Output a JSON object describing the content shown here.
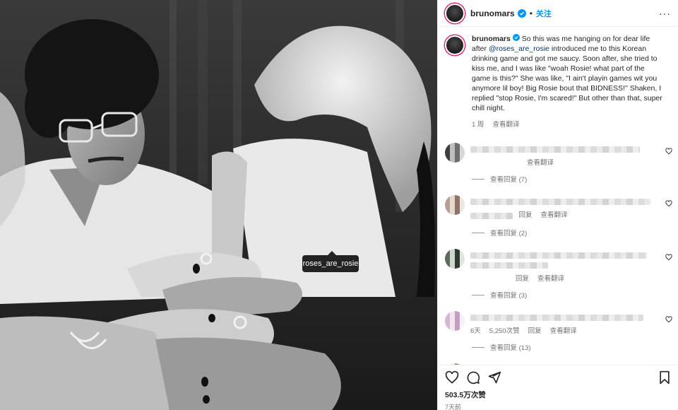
{
  "photo": {
    "tag_label": "roses_are_rosie"
  },
  "header": {
    "username": "brunomars",
    "separator": "•",
    "follow_label": "关注",
    "more_label": "···"
  },
  "caption": {
    "username": "brunomars",
    "text_before": "So this was me hanging on for dear life after",
    "mention": "@roses_are_rosie",
    "text_after": "introduced me to this Korean drinking game and got me saucy. Soon after, she tried to kiss me, and I was like \"woah Rosie! what part of the game is this?\" She was like, \"I ain't playin games wit you anymore lil boy! Big Rosie bout that BIDNESS!\" Shaken, I replied \"stop Rosie, I'm scared!\" But other than that, super chill night.",
    "time": "1 周",
    "translate": "查看翻译"
  },
  "comments": [
    {
      "meta": [
        "查看翻译"
      ],
      "replies": "查看回复 (7)"
    },
    {
      "meta": [
        "回复",
        "查看翻译"
      ],
      "replies": "查看回复 (2)"
    },
    {
      "meta": [
        "回复",
        "查看翻译"
      ],
      "replies": "查看回复 (3)"
    },
    {
      "meta": [
        "6天",
        "5,250次赞",
        "回复",
        "查看翻译"
      ],
      "replies": "查看回复 (13)"
    },
    {
      "meta": [],
      "replies": ""
    }
  ],
  "footer": {
    "likes": "503.5万次赞",
    "date": "7天前"
  },
  "colors": {
    "accent": "#0095f6",
    "verified": "#0095f6",
    "muted": "#737373"
  },
  "icons": {
    "verified": "verified-badge-icon",
    "more": "more-options-icon",
    "heart": "heart-icon",
    "comment": "comment-icon",
    "share": "share-icon",
    "save": "bookmark-icon"
  }
}
